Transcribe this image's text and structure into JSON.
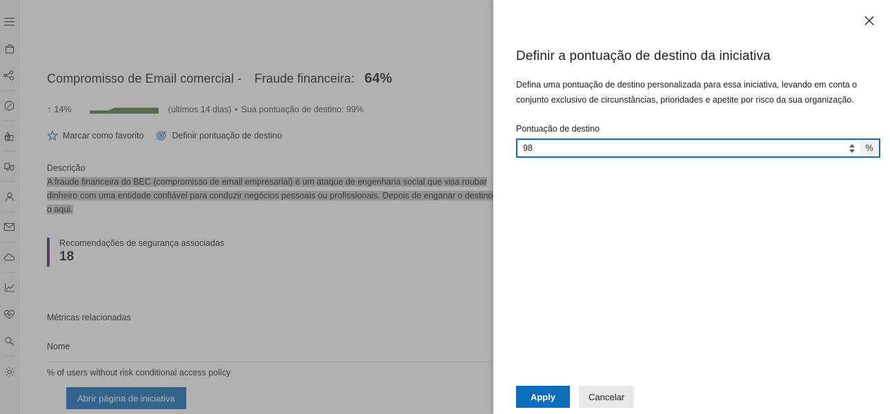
{
  "sidebar": {
    "items": [
      {
        "name": "hamburger-menu-icon",
        "label": "Menu"
      },
      {
        "name": "home-icon",
        "label": "Home"
      },
      {
        "name": "incidents-icon",
        "label": "Incidentes"
      },
      {
        "name": "hunting-icon",
        "label": "Busca"
      },
      {
        "name": "partners-icon",
        "label": "Parceiros"
      },
      {
        "name": "assets-icon",
        "label": "Ativos"
      },
      {
        "name": "identities-icon",
        "label": "Identidades"
      },
      {
        "name": "email-icon",
        "label": "Email"
      },
      {
        "name": "cloud-apps-icon",
        "label": "Aplicativos de nuvem"
      },
      {
        "name": "reports-icon",
        "label": "Relatórios"
      },
      {
        "name": "health-icon",
        "label": "Integridade"
      },
      {
        "name": "permissions-icon",
        "label": "Permissões"
      },
      {
        "name": "settings-icon",
        "label": "Configurações"
      }
    ]
  },
  "initiative": {
    "title": "Compromisso de Email comercial -",
    "subtitle": "Fraude financeira:",
    "score": "64%",
    "trend_arrow": "↑",
    "trend_pct": "14%",
    "trend_period": "(últimos 14 dias)",
    "dot": "•",
    "target_text": "Sua pontuação de destino: 99%",
    "favorite_action": "Marcar como favorito",
    "target_action": "Definir pontuação de destino",
    "description_label": "Descrição",
    "description_line1": "A fraude financeira do BEC (compromisso de email empresarial) é um ataque de engenharia social que visa roubar",
    "description_line2": "dinheiro com uma entidade confiável para conduzir negócios pessoais ou profissionais. Depois de enganar o destino,",
    "description_line3": "o aqui.",
    "kpi_label": "Recomendações de segurança associadas",
    "kpi_value": "18",
    "metrics_heading": "Métricas relacionadas",
    "metrics_column_name": "Nome",
    "metrics_row_1": "% of users without risk conditional access policy",
    "open_button": "Abrir página de iniciativa"
  },
  "panel": {
    "close_label": "Fechar",
    "title": "Definir a pontuação de destino da iniciativa",
    "description": "Defina uma pontuação de destino personalizada para essa iniciativa, levando em conta o conjunto exclusivo de circunstâncias, prioridades e apetite por risco da sua organização.",
    "field_label": "Pontuação de destino",
    "field_value": "98",
    "field_placeholder": "",
    "field_suffix": "%",
    "apply_label": "Apply",
    "cancel_label": "Cancelar"
  },
  "colors": {
    "accent_blue": "#0f6cbd",
    "kpi_bar_purple": "#4a2b6b",
    "sparkline_green": "#5a7d4a",
    "neutral_bg": "#f3f2f1",
    "text_primary": "#201f1e"
  }
}
